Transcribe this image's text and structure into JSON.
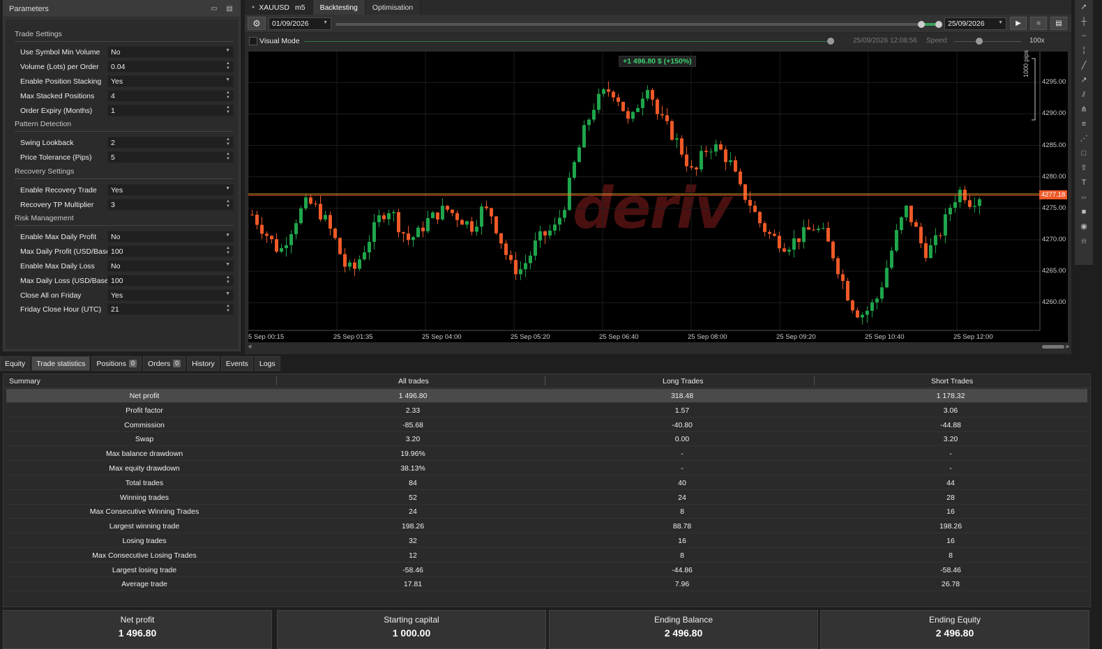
{
  "params_panel": {
    "title": "Parameters",
    "sections": [
      {
        "title": "Trade Settings"
      },
      {
        "title": "Pattern Detection"
      },
      {
        "title": "Recovery Settings"
      },
      {
        "title": "Risk Management"
      }
    ],
    "rows": [
      {
        "label": "Use Symbol Min Volume",
        "value": "No",
        "kind": "select"
      },
      {
        "label": "Volume (Lots) per Order",
        "value": "0.04",
        "kind": "spin"
      },
      {
        "label": "Enable Position Stacking",
        "value": "Yes",
        "kind": "select"
      },
      {
        "label": "Max Stacked Positions",
        "value": "4",
        "kind": "spin"
      },
      {
        "label": "Order Expiry (Months)",
        "value": "1",
        "kind": "spin"
      },
      {
        "label": "Swing Lookback",
        "value": "2",
        "kind": "spin"
      },
      {
        "label": "Price Tolerance (Pips)",
        "value": "5",
        "kind": "spin"
      },
      {
        "label": "Enable Recovery Trade",
        "value": "Yes",
        "kind": "select"
      },
      {
        "label": "Recovery TP Multiplier",
        "value": "3",
        "kind": "spin"
      },
      {
        "label": "Enable Max Daily Profit",
        "value": "No",
        "kind": "select"
      },
      {
        "label": "Max Daily Profit (USD/Base)",
        "value": "100",
        "kind": "spin"
      },
      {
        "label": "Enable Max Daily Loss",
        "value": "No",
        "kind": "select"
      },
      {
        "label": "Max Daily Loss (USD/Base)",
        "value": "100",
        "kind": "spin"
      },
      {
        "label": "Close All on Friday",
        "value": "Yes",
        "kind": "select"
      },
      {
        "label": "Friday Close Hour (UTC)",
        "value": "21",
        "kind": "spin"
      }
    ]
  },
  "center_tabs": {
    "symbol": "XAUUSD",
    "timeframe": "m5",
    "backtesting": "Backtesting",
    "optimisation": "Optimisation"
  },
  "backtest_bar": {
    "start_date": "01/09/2026",
    "end_date": "25/09/2026"
  },
  "visual_mode": {
    "label": "Visual Mode",
    "time": "25/09/2026 12:08:56",
    "speed_label": "Speed:",
    "speed_value": "100x"
  },
  "chart_data": {
    "type": "candlestick",
    "symbol": "XAUUSD",
    "timeframe": "m5",
    "watermark": "deriv",
    "pl_badge": "+1 496.80 $ (+150%)",
    "current_price": "4277.18",
    "scale_label": "1000 pips",
    "y_ticks": [
      "4295.00",
      "4290.00",
      "4285.00",
      "4280.00",
      "4275.00",
      "4270.00",
      "4265.00",
      "4260.00"
    ],
    "y_values": [
      4295,
      4290,
      4285,
      4280,
      4275,
      4270,
      4265,
      4260
    ],
    "ylim": [
      4255.6,
      4299.9
    ],
    "current_price_value": 4277.18,
    "x_ticks": [
      "5 Sep 00:15",
      "25 Sep 01:35",
      "25 Sep 04:00",
      "25 Sep 05:20",
      "25 Sep 06:40",
      "25 Sep 08:00",
      "25 Sep 09:20",
      "25 Sep 10:40",
      "25 Sep 12:00"
    ],
    "colors": {
      "up": "#1fa64c",
      "down": "#f05a28",
      "grid": "#1d1d1d",
      "price_line": "#f05a28"
    },
    "close_path": [
      4274,
      4272,
      4270,
      4268,
      4271,
      4274,
      4276,
      4275,
      4273,
      4270,
      4266,
      4265,
      4268,
      4271,
      4274,
      4275,
      4272,
      4270,
      4271,
      4273,
      4274,
      4275,
      4274,
      4273,
      4272,
      4275,
      4274,
      4270,
      4266,
      4265,
      4267,
      4270,
      4271,
      4272,
      4276,
      4282,
      4287,
      4291,
      4293,
      4294,
      4292,
      4288,
      4292,
      4295,
      4290,
      4288,
      4286,
      4283,
      4280,
      4284,
      4285,
      4284,
      4282,
      4278,
      4276,
      4273,
      4271,
      4270,
      4269,
      4270,
      4271,
      4272,
      4271,
      4268,
      4264,
      4260,
      4258,
      4259,
      4261,
      4266,
      4271,
      4275,
      4272,
      4268,
      4269,
      4272,
      4276,
      4278,
      4276,
      4277
    ]
  },
  "bottom_tabs": [
    {
      "label": "Equity",
      "count": ""
    },
    {
      "label": "Trade statistics",
      "count": ""
    },
    {
      "label": "Positions",
      "count": "0"
    },
    {
      "label": "Orders",
      "count": "0"
    },
    {
      "label": "History",
      "count": ""
    },
    {
      "label": "Events",
      "count": ""
    },
    {
      "label": "Logs",
      "count": ""
    }
  ],
  "stats": {
    "headers": [
      "Summary",
      "All trades",
      "Long Trades",
      "Short Trades"
    ],
    "rows": [
      [
        "Net profit",
        "1 496.80",
        "318.48",
        "1 178.32"
      ],
      [
        "Profit factor",
        "2.33",
        "1.57",
        "3.06"
      ],
      [
        "Commission",
        "-85.68",
        "-40.80",
        "-44.88"
      ],
      [
        "Swap",
        "3.20",
        "0.00",
        "3.20"
      ],
      [
        "Max balance drawdown",
        "19.96%",
        "-",
        "-"
      ],
      [
        "Max equity drawdown",
        "38.13%",
        "-",
        "-"
      ],
      [
        "Total trades",
        "84",
        "40",
        "44"
      ],
      [
        "Winning trades",
        "52",
        "24",
        "28"
      ],
      [
        "Max Consecutive Winning Trades",
        "24",
        "8",
        "16"
      ],
      [
        "Largest winning trade",
        "198.26",
        "88.78",
        "198.26"
      ],
      [
        "Losing trades",
        "32",
        "16",
        "16"
      ],
      [
        "Max Consecutive Losing Trades",
        "12",
        "8",
        "8"
      ],
      [
        "Largest losing trade",
        "-58.46",
        "-44.86",
        "-58.46"
      ],
      [
        "Average trade",
        "17.81",
        "7.96",
        "26.78"
      ]
    ]
  },
  "summary_cards": [
    {
      "label": "Net profit",
      "value": "1 496.80"
    },
    {
      "label": "Starting capital",
      "value": "1 000.00"
    },
    {
      "label": "Ending Balance",
      "value": "2 496.80"
    },
    {
      "label": "Ending Equity",
      "value": "2 496.80"
    }
  ],
  "right_toolbar": [
    "cursor-icon",
    "crosshair-icon",
    "horizontal-line-icon",
    "vertical-line-icon",
    "trend-line-icon",
    "ray-icon",
    "channel-icon",
    "pitchfork-icon",
    "fibonacci-icon",
    "fan-icon",
    "rectangle-icon",
    "arrow-icon",
    "text-icon",
    "measure-icon",
    "fill-icon",
    "camera-icon",
    "alert-icon"
  ]
}
